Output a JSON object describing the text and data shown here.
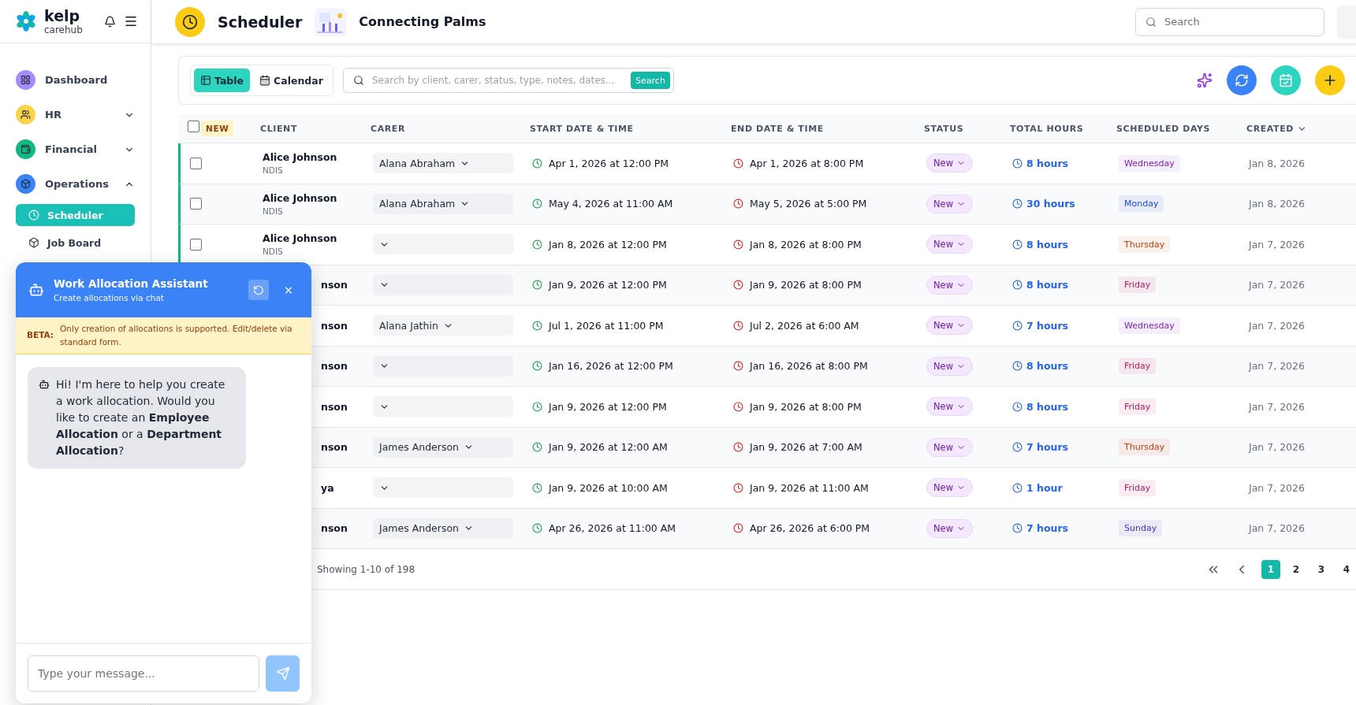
{
  "brand": {
    "name": "kelp",
    "sub": "carehub"
  },
  "sidebar": {
    "items": [
      {
        "label": "Dashboard",
        "kind": "link",
        "color": "#a78bfa"
      },
      {
        "label": "HR",
        "kind": "group",
        "color": "#fcd34d",
        "expanded": false
      },
      {
        "label": "Financial",
        "kind": "group",
        "color": "#10b981",
        "expanded": false
      },
      {
        "label": "Operations",
        "kind": "group",
        "color": "#3b82f6",
        "expanded": true,
        "children": [
          {
            "label": "Scheduler",
            "selected": true
          },
          {
            "label": "Job Board",
            "selected": false
          }
        ]
      }
    ]
  },
  "header": {
    "title": "Scheduler",
    "org": "Connecting Palms",
    "search": {
      "placeholder": "Search"
    }
  },
  "toolbar": {
    "views": [
      {
        "label": "Table",
        "selected": true
      },
      {
        "label": "Calendar",
        "selected": false
      }
    ],
    "search": {
      "placeholder": "Search by client, carer, status, type, notes, dates...",
      "button": "Search"
    }
  },
  "table": {
    "new_badge": "NEW",
    "select_all_checked": false,
    "columns": [
      {
        "label": "CLIENT"
      },
      {
        "label": "CARER"
      },
      {
        "label": "START DATE & TIME"
      },
      {
        "label": "END DATE & TIME"
      },
      {
        "label": "STATUS"
      },
      {
        "label": "TOTAL HOURS"
      },
      {
        "label": "SCHEDULED DAYS"
      },
      {
        "label": "CREATED",
        "sorted": true
      }
    ],
    "rows": [
      {
        "checked": false,
        "client": "Alice Johnson",
        "funding": "NDIS",
        "covered": false,
        "carer": "Alana Abraham",
        "start": "Apr 1, 2026 at 12:00 PM",
        "end": "Apr 1, 2026 at 8:00 PM",
        "status": "New",
        "hours": "8 hours",
        "day": "Wednesday",
        "color": "#7e22ce",
        "created": "Jan 8, 2026"
      },
      {
        "checked": false,
        "client": "Alice Johnson",
        "funding": "NDIS",
        "covered": false,
        "carer": "Alana Abraham",
        "start": "May 4, 2026 at 11:00 AM",
        "end": "May 5, 2026 at 5:00 PM",
        "status": "New",
        "hours": "30 hours",
        "day": "Monday",
        "color": "#1d4ed8",
        "created": "Jan 8, 2026"
      },
      {
        "checked": false,
        "client": "Alice Johnson",
        "funding": "NDIS",
        "covered": false,
        "start": "Jan 8, 2026 at 12:00 PM",
        "end": "Jan 8, 2026 at 8:00 PM",
        "status": "New",
        "hours": "8 hours",
        "day": "Thursday",
        "color": "#c2410c",
        "created": "Jan 7, 2026"
      },
      {
        "client": "nson",
        "covered": true,
        "start": "Jan 9, 2026 at 12:00 PM",
        "end": "Jan 9, 2026 at 8:00 PM",
        "status": "New",
        "hours": "8 hours",
        "day": "Friday",
        "color": "#be185d",
        "created": "Jan 7, 2026"
      },
      {
        "client": "nson",
        "covered": true,
        "carer": "Alana Jathin",
        "start": "Jul 1, 2026 at 11:00 PM",
        "end": "Jul 2, 2026 at 6:00 AM",
        "status": "New",
        "hours": "7 hours",
        "day": "Wednesday",
        "color": "#7e22ce",
        "created": "Jan 7, 2026"
      },
      {
        "client": "nson",
        "covered": true,
        "start": "Jan 16, 2026 at 12:00 PM",
        "end": "Jan 16, 2026 at 8:00 PM",
        "status": "New",
        "hours": "8 hours",
        "day": "Friday",
        "color": "#be185d",
        "created": "Jan 7, 2026"
      },
      {
        "client": "nson",
        "covered": true,
        "start": "Jan 9, 2026 at 12:00 PM",
        "end": "Jan 9, 2026 at 8:00 PM",
        "status": "New",
        "hours": "8 hours",
        "day": "Friday",
        "color": "#be185d",
        "created": "Jan 7, 2026"
      },
      {
        "client": "nson",
        "covered": true,
        "carer": "James Anderson",
        "start": "Jan 9, 2026 at 12:00 AM",
        "end": "Jan 9, 2026 at 7:00 AM",
        "status": "New",
        "hours": "7 hours",
        "day": "Thursday",
        "color": "#c2410c",
        "created": "Jan 7, 2026"
      },
      {
        "client": "ya",
        "covered": true,
        "start": "Jan 9, 2026 at 10:00 AM",
        "end": "Jan 9, 2026 at 11:00 AM",
        "status": "New",
        "hours": "1 hour",
        "day": "Friday",
        "color": "#be185d",
        "created": "Jan 7, 2026"
      },
      {
        "client": "nson",
        "covered": true,
        "carer": "James Anderson",
        "start": "Apr 26, 2026 at 11:00 AM",
        "end": "Apr 26, 2026 at 6:00 PM",
        "status": "New",
        "hours": "7 hours",
        "day": "Sunday",
        "color": "#4338ca",
        "created": "Jan 7, 2026"
      }
    ]
  },
  "pagination": {
    "summary": "Showing 1-10 of 198",
    "pages": [
      {
        "label": "1",
        "selected": true
      },
      {
        "label": "2",
        "selected": false
      },
      {
        "label": "3",
        "selected": false
      },
      {
        "label": "4",
        "selected": false
      }
    ]
  },
  "chat": {
    "title": "Work Allocation Assistant",
    "subtitle": "Create allocations via chat",
    "beta_label": "BETA:",
    "beta_text": "Only creation of allocations is supported. Edit/delete via standard form.",
    "messages": [
      {
        "text": "Hi! I'm here to help you create a work allocation. Would you like to create an **Employee Allocation** or a **Department Allocation**?"
      }
    ],
    "input": {
      "placeholder": "Type your message..."
    }
  }
}
